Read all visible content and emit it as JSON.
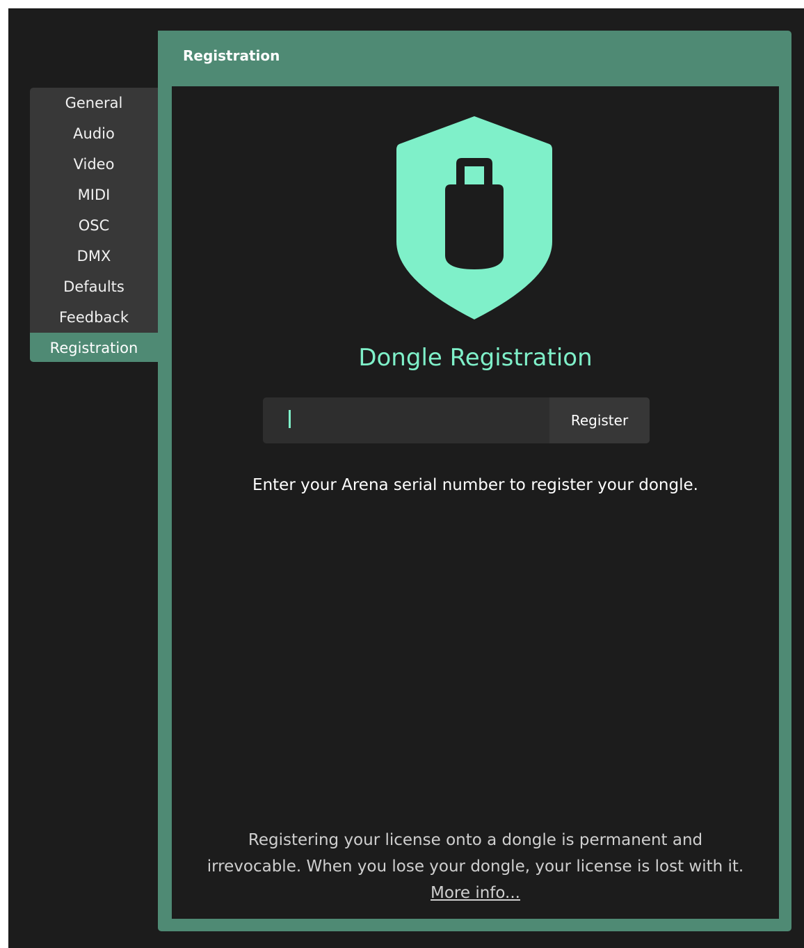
{
  "sidebar": {
    "items": [
      {
        "label": "General"
      },
      {
        "label": "Audio"
      },
      {
        "label": "Video"
      },
      {
        "label": "MIDI"
      },
      {
        "label": "OSC"
      },
      {
        "label": "DMX"
      },
      {
        "label": "Defaults"
      },
      {
        "label": "Feedback"
      },
      {
        "label": "Registration",
        "active": true
      }
    ]
  },
  "panel": {
    "title": "Registration"
  },
  "main": {
    "icon": "usb-dongle-shield-icon",
    "heading": "Dongle Registration",
    "serial_input": {
      "value": "",
      "placeholder": ""
    },
    "register_label": "Register",
    "instructions": "Enter your Arena serial number to register your dongle.",
    "disclaimer_line1": "Registering your license onto a dongle is permanent and",
    "disclaimer_line2": "irrevocable. When you lose your dongle, your license is lost with it.",
    "more_info_label": "More info..."
  },
  "colors": {
    "accent": "#7ff0c9",
    "panel_green": "#4f8a74",
    "background": "#1c1c1c",
    "sidebar_bg": "#383838"
  }
}
